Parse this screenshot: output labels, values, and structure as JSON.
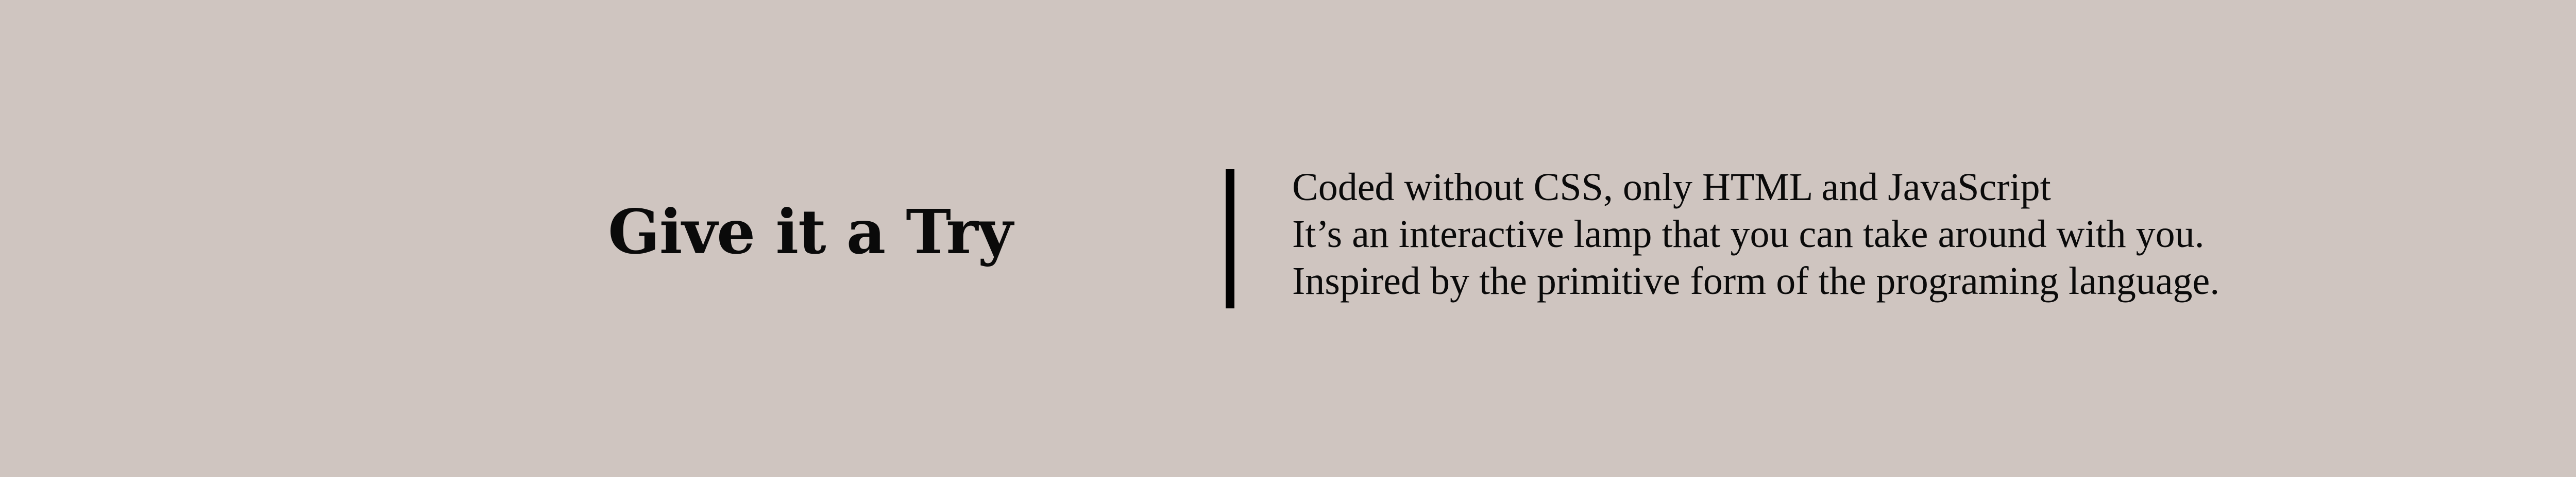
{
  "heading": {
    "title": "Give it a Try"
  },
  "description": {
    "lines": [
      "Coded without CSS, only HTML and JavaScript",
      "It’s an interactive lamp that you can take around with you.",
      "Inspired by the primitive form of the programing language."
    ]
  },
  "colors": {
    "background": "#cfc5c0",
    "text": "#0a0a0a",
    "divider": "#000000"
  }
}
